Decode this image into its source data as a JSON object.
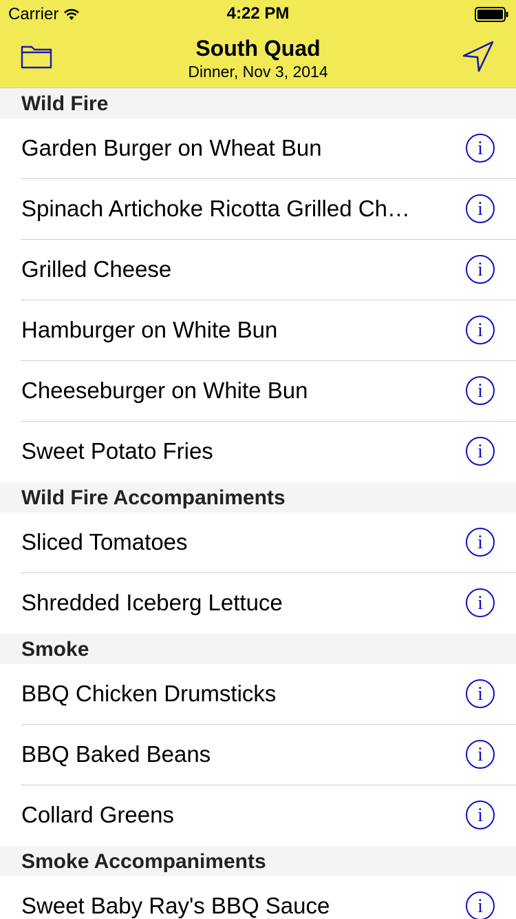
{
  "status_bar": {
    "carrier": "Carrier",
    "time": "4:22 PM"
  },
  "nav": {
    "title": "South Quad",
    "subtitle": "Dinner, Nov 3, 2014",
    "left_icon": "folder-icon",
    "right_icon": "location-arrow-icon"
  },
  "colors": {
    "nav_background": "#f1ea55",
    "info_icon": "#1010c0",
    "section_background": "#f4f4f4"
  },
  "sections": [
    {
      "header": "Wild Fire",
      "items": [
        "Garden Burger on Wheat Bun",
        "Spinach Artichoke Ricotta Grilled Ch…",
        "Grilled Cheese",
        "Hamburger on White Bun",
        "Cheeseburger on White Bun",
        "Sweet Potato Fries"
      ]
    },
    {
      "header": "Wild Fire Accompaniments",
      "items": [
        "Sliced Tomatoes",
        "Shredded Iceberg Lettuce"
      ]
    },
    {
      "header": "Smoke",
      "items": [
        "BBQ Chicken Drumsticks",
        "BBQ Baked Beans",
        "Collard Greens"
      ]
    },
    {
      "header": "Smoke Accompaniments",
      "items": [
        "Sweet Baby Ray's BBQ Sauce"
      ]
    }
  ]
}
